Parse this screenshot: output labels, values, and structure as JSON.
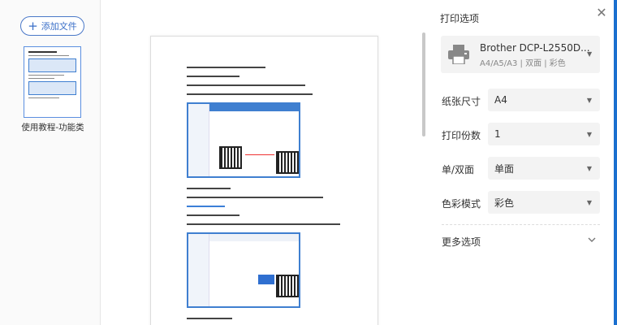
{
  "sidebar": {
    "add_file_label": "添加文件",
    "thumbnail_label": "使用教程-功能类"
  },
  "settings": {
    "title": "打印选项",
    "printer": {
      "name": "Brother DCP-L2550D...",
      "paper_info": "A4/A5/A3 | 双面 | 彩色"
    },
    "rows": [
      {
        "label": "纸张尺寸",
        "value": "A4"
      },
      {
        "label": "打印份数",
        "value": "1"
      },
      {
        "label": "单/双面",
        "value": "单面"
      },
      {
        "label": "色彩模式",
        "value": "彩色"
      }
    ],
    "more_options": "更多选项"
  }
}
